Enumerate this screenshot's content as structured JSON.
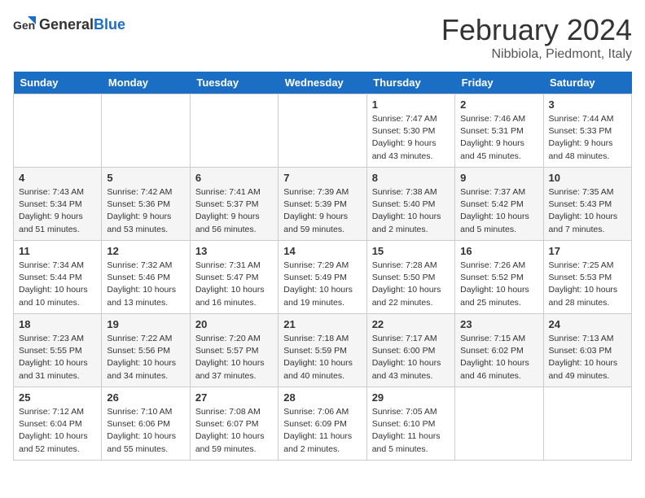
{
  "logo": {
    "text_general": "General",
    "text_blue": "Blue"
  },
  "title": "February 2024",
  "subtitle": "Nibbiola, Piedmont, Italy",
  "days_of_week": [
    "Sunday",
    "Monday",
    "Tuesday",
    "Wednesday",
    "Thursday",
    "Friday",
    "Saturday"
  ],
  "weeks": [
    [
      {
        "day": "",
        "info": ""
      },
      {
        "day": "",
        "info": ""
      },
      {
        "day": "",
        "info": ""
      },
      {
        "day": "",
        "info": ""
      },
      {
        "day": "1",
        "info": "Sunrise: 7:47 AM\nSunset: 5:30 PM\nDaylight: 9 hours and 43 minutes."
      },
      {
        "day": "2",
        "info": "Sunrise: 7:46 AM\nSunset: 5:31 PM\nDaylight: 9 hours and 45 minutes."
      },
      {
        "day": "3",
        "info": "Sunrise: 7:44 AM\nSunset: 5:33 PM\nDaylight: 9 hours and 48 minutes."
      }
    ],
    [
      {
        "day": "4",
        "info": "Sunrise: 7:43 AM\nSunset: 5:34 PM\nDaylight: 9 hours and 51 minutes."
      },
      {
        "day": "5",
        "info": "Sunrise: 7:42 AM\nSunset: 5:36 PM\nDaylight: 9 hours and 53 minutes."
      },
      {
        "day": "6",
        "info": "Sunrise: 7:41 AM\nSunset: 5:37 PM\nDaylight: 9 hours and 56 minutes."
      },
      {
        "day": "7",
        "info": "Sunrise: 7:39 AM\nSunset: 5:39 PM\nDaylight: 9 hours and 59 minutes."
      },
      {
        "day": "8",
        "info": "Sunrise: 7:38 AM\nSunset: 5:40 PM\nDaylight: 10 hours and 2 minutes."
      },
      {
        "day": "9",
        "info": "Sunrise: 7:37 AM\nSunset: 5:42 PM\nDaylight: 10 hours and 5 minutes."
      },
      {
        "day": "10",
        "info": "Sunrise: 7:35 AM\nSunset: 5:43 PM\nDaylight: 10 hours and 7 minutes."
      }
    ],
    [
      {
        "day": "11",
        "info": "Sunrise: 7:34 AM\nSunset: 5:44 PM\nDaylight: 10 hours and 10 minutes."
      },
      {
        "day": "12",
        "info": "Sunrise: 7:32 AM\nSunset: 5:46 PM\nDaylight: 10 hours and 13 minutes."
      },
      {
        "day": "13",
        "info": "Sunrise: 7:31 AM\nSunset: 5:47 PM\nDaylight: 10 hours and 16 minutes."
      },
      {
        "day": "14",
        "info": "Sunrise: 7:29 AM\nSunset: 5:49 PM\nDaylight: 10 hours and 19 minutes."
      },
      {
        "day": "15",
        "info": "Sunrise: 7:28 AM\nSunset: 5:50 PM\nDaylight: 10 hours and 22 minutes."
      },
      {
        "day": "16",
        "info": "Sunrise: 7:26 AM\nSunset: 5:52 PM\nDaylight: 10 hours and 25 minutes."
      },
      {
        "day": "17",
        "info": "Sunrise: 7:25 AM\nSunset: 5:53 PM\nDaylight: 10 hours and 28 minutes."
      }
    ],
    [
      {
        "day": "18",
        "info": "Sunrise: 7:23 AM\nSunset: 5:55 PM\nDaylight: 10 hours and 31 minutes."
      },
      {
        "day": "19",
        "info": "Sunrise: 7:22 AM\nSunset: 5:56 PM\nDaylight: 10 hours and 34 minutes."
      },
      {
        "day": "20",
        "info": "Sunrise: 7:20 AM\nSunset: 5:57 PM\nDaylight: 10 hours and 37 minutes."
      },
      {
        "day": "21",
        "info": "Sunrise: 7:18 AM\nSunset: 5:59 PM\nDaylight: 10 hours and 40 minutes."
      },
      {
        "day": "22",
        "info": "Sunrise: 7:17 AM\nSunset: 6:00 PM\nDaylight: 10 hours and 43 minutes."
      },
      {
        "day": "23",
        "info": "Sunrise: 7:15 AM\nSunset: 6:02 PM\nDaylight: 10 hours and 46 minutes."
      },
      {
        "day": "24",
        "info": "Sunrise: 7:13 AM\nSunset: 6:03 PM\nDaylight: 10 hours and 49 minutes."
      }
    ],
    [
      {
        "day": "25",
        "info": "Sunrise: 7:12 AM\nSunset: 6:04 PM\nDaylight: 10 hours and 52 minutes."
      },
      {
        "day": "26",
        "info": "Sunrise: 7:10 AM\nSunset: 6:06 PM\nDaylight: 10 hours and 55 minutes."
      },
      {
        "day": "27",
        "info": "Sunrise: 7:08 AM\nSunset: 6:07 PM\nDaylight: 10 hours and 59 minutes."
      },
      {
        "day": "28",
        "info": "Sunrise: 7:06 AM\nSunset: 6:09 PM\nDaylight: 11 hours and 2 minutes."
      },
      {
        "day": "29",
        "info": "Sunrise: 7:05 AM\nSunset: 6:10 PM\nDaylight: 11 hours and 5 minutes."
      },
      {
        "day": "",
        "info": ""
      },
      {
        "day": "",
        "info": ""
      }
    ]
  ]
}
